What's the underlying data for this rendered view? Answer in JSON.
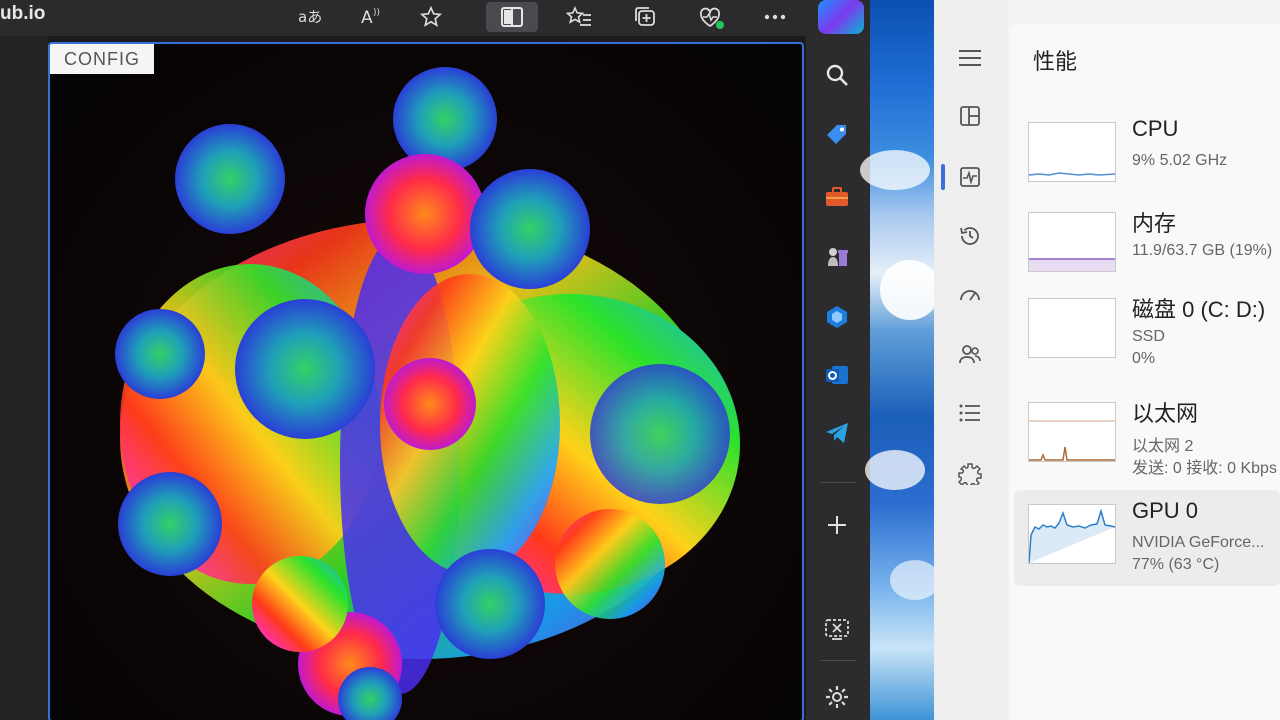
{
  "browser": {
    "url_fragment": "ub.io",
    "toolbar_icons": [
      "read-aloud-translate-icon",
      "text-size-icon",
      "favorite-star-icon",
      "split-screen-icon",
      "favorites-list-icon",
      "collections-icon",
      "browser-essentials-icon",
      "more-options-icon"
    ],
    "active_toolbar_icon": "split-screen-icon",
    "sidebar_icons": [
      "search-icon",
      "shopping-tag-icon",
      "tools-briefcase-icon",
      "games-chess-icon",
      "copilot-icon",
      "outlook-icon",
      "telegram-icon",
      "add-icon",
      "screenshot-icon",
      "settings-icon"
    ]
  },
  "canvas": {
    "config_button": "CONFIG",
    "border_color": "#3a6fd8"
  },
  "task_manager": {
    "title": "性能",
    "nav_icons": [
      "hamburger-menu-icon",
      "processes-icon",
      "performance-icon",
      "app-history-icon",
      "startup-apps-icon",
      "users-icon",
      "details-icon",
      "services-icon"
    ],
    "active_nav": "performance-icon",
    "items": [
      {
        "name": "CPU",
        "line1": "9% 5.02 GHz",
        "line2": "",
        "graph_color": "#4c8fd6",
        "selected": false
      },
      {
        "name": "内存",
        "line1": "11.9/63.7 GB (19%)",
        "line2": "",
        "graph_color": "#8b5fbf",
        "selected": false
      },
      {
        "name": "磁盘 0 (C: D:)",
        "line1": "SSD",
        "line2": "0%",
        "graph_color": "#4ea84e",
        "selected": false
      },
      {
        "name": "以太网",
        "line1": "以太网 2",
        "line2": "发送: 0 接收: 0 Kbps",
        "graph_color": "#b06a3a",
        "selected": false
      },
      {
        "name": "GPU 0",
        "line1": "NVIDIA GeForce...",
        "line2": "77% (63 °C)",
        "graph_color": "#2d7fc9",
        "selected": true
      }
    ]
  }
}
